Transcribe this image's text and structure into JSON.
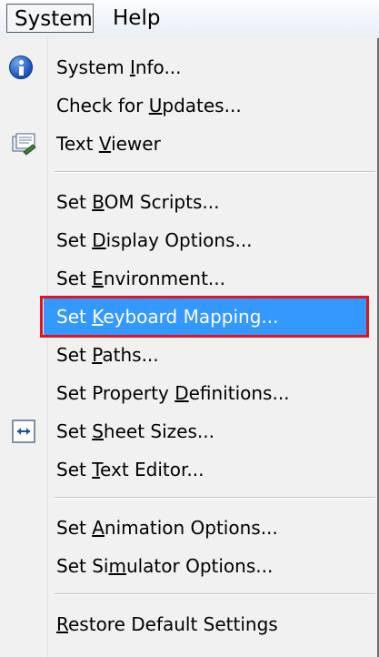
{
  "menubar": {
    "system_label": "System",
    "help_label": "Help"
  },
  "menu": {
    "items": [
      {
        "id": "system-info",
        "before": "System ",
        "key": "I",
        "after": "nfo...",
        "icon": "info-icon"
      },
      {
        "id": "check-for-updates",
        "before": "Check for ",
        "key": "U",
        "after": "pdates..."
      },
      {
        "id": "text-viewer",
        "before": "Text ",
        "key": "V",
        "after": "iewer",
        "icon": "text-viewer-icon"
      },
      {
        "id": "set-bom-scripts",
        "before": "Set ",
        "key": "B",
        "after": "OM Scripts..."
      },
      {
        "id": "set-display-options",
        "before": "Set ",
        "key": "D",
        "after": "isplay Options..."
      },
      {
        "id": "set-environment",
        "before": "Set ",
        "key": "E",
        "after": "nvironment..."
      },
      {
        "id": "set-keyboard-mapping",
        "before": "Set ",
        "key": "K",
        "after": "eyboard Mapping...",
        "highlighted": true
      },
      {
        "id": "set-paths",
        "before": "Set ",
        "key": "P",
        "after": "aths..."
      },
      {
        "id": "set-property-definitions",
        "before": "Set Property ",
        "key": "D",
        "after": "efinitions..."
      },
      {
        "id": "set-sheet-sizes",
        "before": "Set ",
        "key": "S",
        "after": "heet Sizes...",
        "icon": "sheet-size-icon"
      },
      {
        "id": "set-text-editor",
        "before": "Set ",
        "key": "T",
        "after": "ext Editor..."
      },
      {
        "id": "set-animation-options",
        "before": "Set ",
        "key": "A",
        "after": "nimation Options..."
      },
      {
        "id": "set-simulator-options",
        "before": "Set Si",
        "key": "m",
        "after": "ulator Options..."
      },
      {
        "id": "restore-default-settings",
        "before": "",
        "key": "R",
        "after": "estore Default Settings"
      }
    ]
  },
  "colors": {
    "highlight": "#3399ff",
    "highlight_frame": "#e0161c",
    "menu_bg": "#f1f1f1"
  }
}
